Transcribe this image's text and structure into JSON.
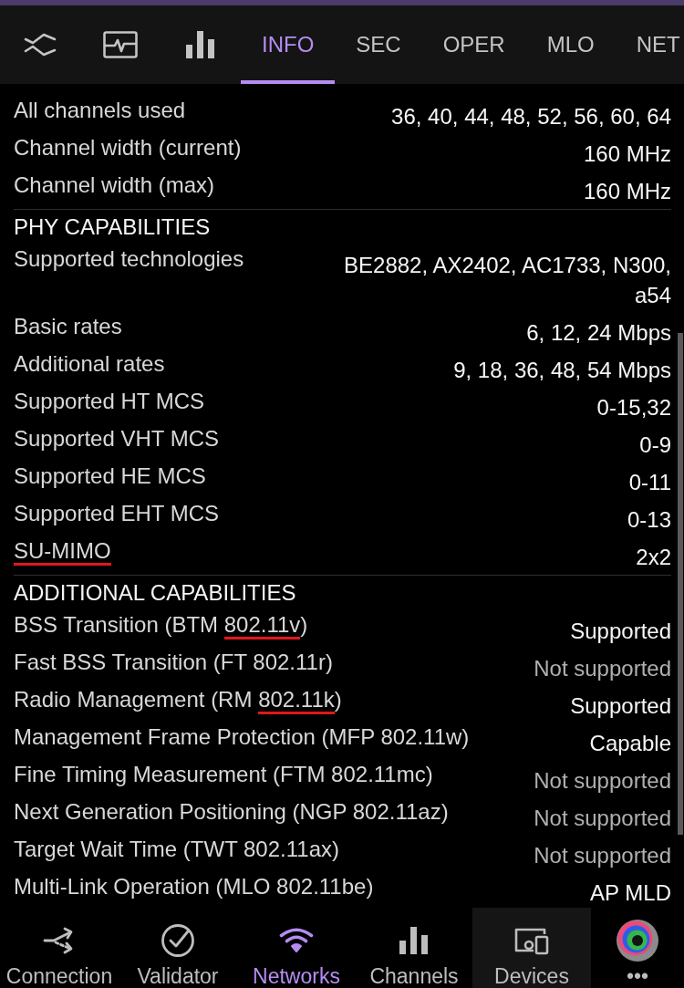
{
  "tabs": [
    {
      "kind": "icon",
      "selected": false
    },
    {
      "kind": "icon",
      "selected": false
    },
    {
      "kind": "icon",
      "selected": false
    },
    {
      "kind": "text",
      "label": "INFO",
      "selected": true
    },
    {
      "kind": "text",
      "label": "SEC",
      "selected": false
    },
    {
      "kind": "text",
      "label": "OPER",
      "selected": false
    },
    {
      "kind": "text",
      "label": "MLO",
      "selected": false
    },
    {
      "kind": "text",
      "label": "NET",
      "selected": false
    }
  ],
  "sections": [
    {
      "rows": [
        {
          "label": "All channels used",
          "value": "36, 40, 44, 48, 52, 56, 60, 64"
        },
        {
          "label": "Channel width (current)",
          "value": "160 MHz"
        },
        {
          "label": "Channel width (max)",
          "value": "160 MHz"
        }
      ]
    },
    {
      "heading": "PHY CAPABILITIES",
      "rows": [
        {
          "label": "Supported technologies",
          "value": "BE2882, AX2402, AC1733, N300, a54"
        },
        {
          "label": "Basic rates",
          "value": "6, 12, 24 Mbps"
        },
        {
          "label": "Additional rates",
          "value": "9, 18, 36, 48, 54 Mbps"
        },
        {
          "label": "Supported HT MCS",
          "value": "0-15,32"
        },
        {
          "label": "Supported VHT MCS",
          "value": "0-9"
        },
        {
          "label": "Supported HE MCS",
          "value": "0-11"
        },
        {
          "label": "Supported EHT MCS",
          "value": "0-13"
        },
        {
          "label_parts": [
            {
              "text": "SU-MIMO",
              "underlined": true
            }
          ],
          "value": "2x2"
        }
      ]
    },
    {
      "heading": "ADDITIONAL CAPABILITIES",
      "rows": [
        {
          "label_parts": [
            {
              "text": "BSS Transition (BTM ",
              "underlined": false
            },
            {
              "text": "802.11v",
              "underlined": true
            },
            {
              "text": ")",
              "underlined": false
            }
          ],
          "value": "Supported",
          "dimmed": false
        },
        {
          "label": "Fast BSS Transition (FT 802.11r)",
          "value": "Not supported",
          "dimmed": true
        },
        {
          "label_parts": [
            {
              "text": "Radio Management (RM ",
              "underlined": false
            },
            {
              "text": "802.11k",
              "underlined": true
            },
            {
              "text": ")",
              "underlined": false
            }
          ],
          "value": "Supported",
          "dimmed": false
        },
        {
          "label": "Management Frame Protection (MFP 802.11w)",
          "value": "Capable",
          "dimmed": false
        },
        {
          "label": "Fine Timing Measurement (FTM 802.11mc)",
          "value": "Not supported",
          "dimmed": true
        },
        {
          "label": "Next Generation Positioning (NGP 802.11az)",
          "value": "Not supported",
          "dimmed": true
        },
        {
          "label": "Target Wait Time (TWT 802.11ax)",
          "value": "Not supported",
          "dimmed": true
        },
        {
          "label": "Multi-Link Operation (MLO 802.11be)",
          "value": "AP MLD",
          "dimmed": false
        }
      ]
    }
  ],
  "bottom_nav": [
    {
      "label": "Connection",
      "selected": false,
      "highlighted": false
    },
    {
      "label": "Validator",
      "selected": false,
      "highlighted": false
    },
    {
      "label": "Networks",
      "selected": true,
      "highlighted": false
    },
    {
      "label": "Channels",
      "selected": false,
      "highlighted": false
    },
    {
      "label": "Devices",
      "selected": false,
      "highlighted": true
    },
    {
      "label": "•••",
      "selected": false,
      "highlighted": false
    }
  ]
}
